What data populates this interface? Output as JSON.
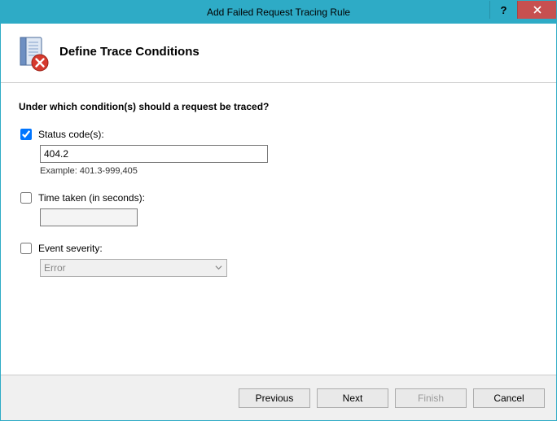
{
  "window": {
    "title": "Add Failed Request Tracing Rule"
  },
  "header": {
    "title": "Define Trace Conditions"
  },
  "content": {
    "question": "Under which condition(s) should a request be traced?",
    "status": {
      "label": "Status code(s):",
      "checked": true,
      "value": "404.2",
      "hint": "Example: 401.3-999,405"
    },
    "time": {
      "label": "Time taken (in seconds):",
      "checked": false,
      "value": ""
    },
    "severity": {
      "label": "Event severity:",
      "checked": false,
      "selected": "Error"
    }
  },
  "footer": {
    "previous": "Previous",
    "next": "Next",
    "finish": "Finish",
    "cancel": "Cancel"
  }
}
